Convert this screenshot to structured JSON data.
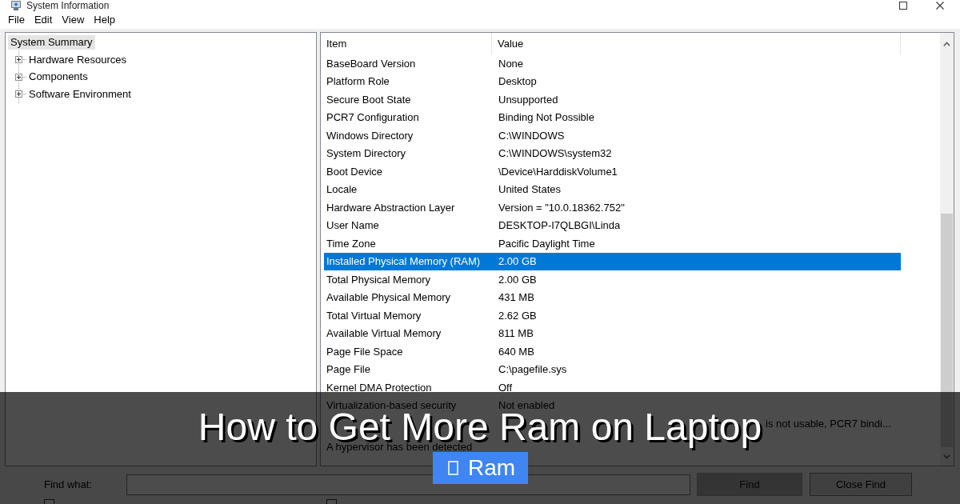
{
  "window": {
    "title": "System Information"
  },
  "menu": [
    "File",
    "Edit",
    "View",
    "Help"
  ],
  "tree": [
    {
      "label": "System Summary",
      "selected": true,
      "children": [
        {
          "label": "Hardware Resources",
          "selected": false,
          "expanded": false
        },
        {
          "label": "Components",
          "selected": false,
          "expanded": false
        },
        {
          "label": "Software Environment",
          "selected": false,
          "expanded": false
        }
      ]
    }
  ],
  "table": {
    "columns": [
      "Item",
      "Value"
    ],
    "rows": [
      {
        "kind": "row",
        "item": "BaseBoard Version",
        "value": "None",
        "selected": false
      },
      {
        "kind": "row",
        "item": "Platform Role",
        "value": "Desktop",
        "selected": false
      },
      {
        "kind": "row",
        "item": "Secure Boot State",
        "value": "Unsupported",
        "selected": false
      },
      {
        "kind": "row",
        "item": "PCR7 Configuration",
        "value": "Binding Not Possible",
        "selected": false
      },
      {
        "kind": "row",
        "item": "Windows Directory",
        "value": "C:\\WINDOWS",
        "selected": false
      },
      {
        "kind": "row",
        "item": "System Directory",
        "value": "C:\\WINDOWS\\system32",
        "selected": false
      },
      {
        "kind": "row",
        "item": "Boot Device",
        "value": "\\Device\\HarddiskVolume1",
        "selected": false
      },
      {
        "kind": "row",
        "item": "Locale",
        "value": "United States",
        "selected": false
      },
      {
        "kind": "row",
        "item": "Hardware Abstraction Layer",
        "value": "Version = \"10.0.18362.752\"",
        "selected": false
      },
      {
        "kind": "row",
        "item": "User Name",
        "value": "DESKTOP-I7QLBGI\\Linda",
        "selected": false
      },
      {
        "kind": "row",
        "item": "Time Zone",
        "value": "Pacific Daylight Time",
        "selected": false
      },
      {
        "kind": "row",
        "item": "Installed Physical Memory (RAM)",
        "value": "2.00 GB",
        "selected": true
      },
      {
        "kind": "row",
        "item": "Total Physical Memory",
        "value": "2.00 GB",
        "selected": false
      },
      {
        "kind": "row",
        "item": "Available Physical Memory",
        "value": "431 MB",
        "selected": false
      },
      {
        "kind": "row",
        "item": "Total Virtual Memory",
        "value": "2.62 GB",
        "selected": false
      },
      {
        "kind": "row",
        "item": "Available Virtual Memory",
        "value": "811 MB",
        "selected": false
      },
      {
        "kind": "row",
        "item": "Page File Space",
        "value": "640 MB",
        "selected": false
      },
      {
        "kind": "row",
        "item": "Page File",
        "value": "C:\\pagefile.sys",
        "selected": false
      },
      {
        "kind": "row",
        "item": "Kernel DMA Protection",
        "value": "Off",
        "selected": false
      },
      {
        "kind": "row",
        "item": "Virtualization-based security",
        "value": "Not enabled",
        "selected": false
      },
      {
        "kind": "covered",
        "value": "is not usable, PCR7 bindi...",
        "selected": false
      },
      {
        "kind": "row",
        "item": "A hypervisor has been detected",
        "selected": false
      }
    ]
  },
  "find_bar": {
    "label": "Find what:",
    "buttons": [
      {
        "label": "Find",
        "disabled": true
      },
      {
        "label": "Close Find",
        "disabled": false
      }
    ],
    "options": [
      {
        "checked": false
      },
      {
        "checked": false
      }
    ]
  },
  "banner": {
    "headline": "How to Get More Ram on Laptop",
    "tag": "Ram"
  }
}
